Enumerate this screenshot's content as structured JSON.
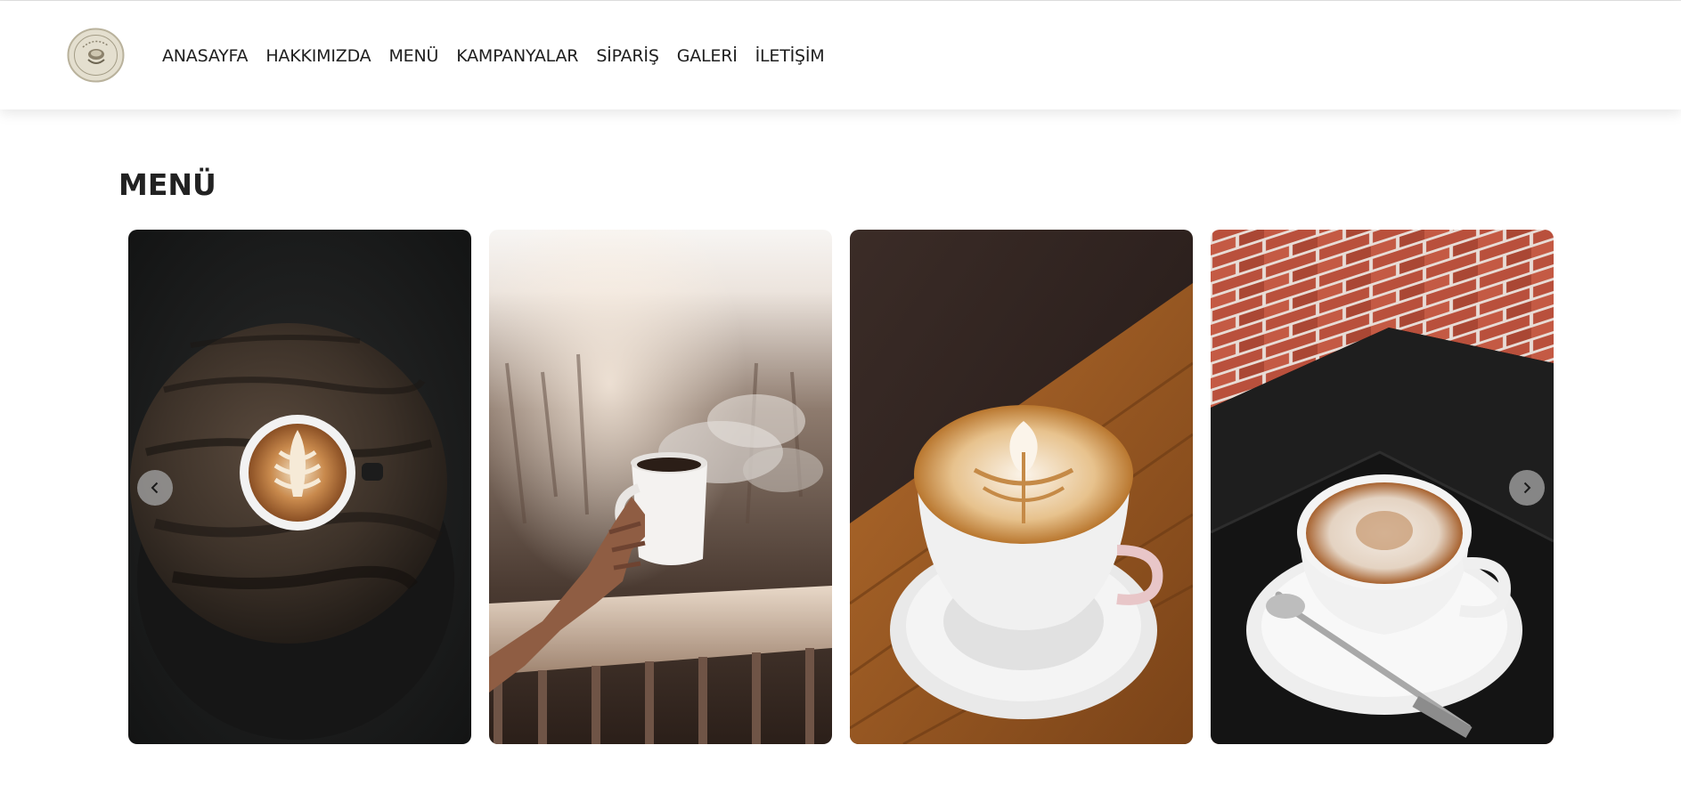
{
  "brand": {
    "logo_icon": "coffee-logo-icon"
  },
  "nav": {
    "items": [
      {
        "label": "ANASAYFA"
      },
      {
        "label": "HAKKIMIZDA"
      },
      {
        "label": "MENÜ"
      },
      {
        "label": "KAMPANYALAR"
      },
      {
        "label": "SİPARİŞ"
      },
      {
        "label": "GALERİ"
      },
      {
        "label": "İLETİŞİM"
      }
    ]
  },
  "menu": {
    "title": "MENÜ",
    "cards": [
      {
        "image": "latte-on-wooden-stool"
      },
      {
        "image": "hand-holding-steaming-mug"
      },
      {
        "image": "latte-art-on-wooden-table"
      },
      {
        "image": "cappuccino-with-spoon"
      }
    ],
    "prev_icon": "chevron-left-icon",
    "next_icon": "chevron-right-icon"
  }
}
